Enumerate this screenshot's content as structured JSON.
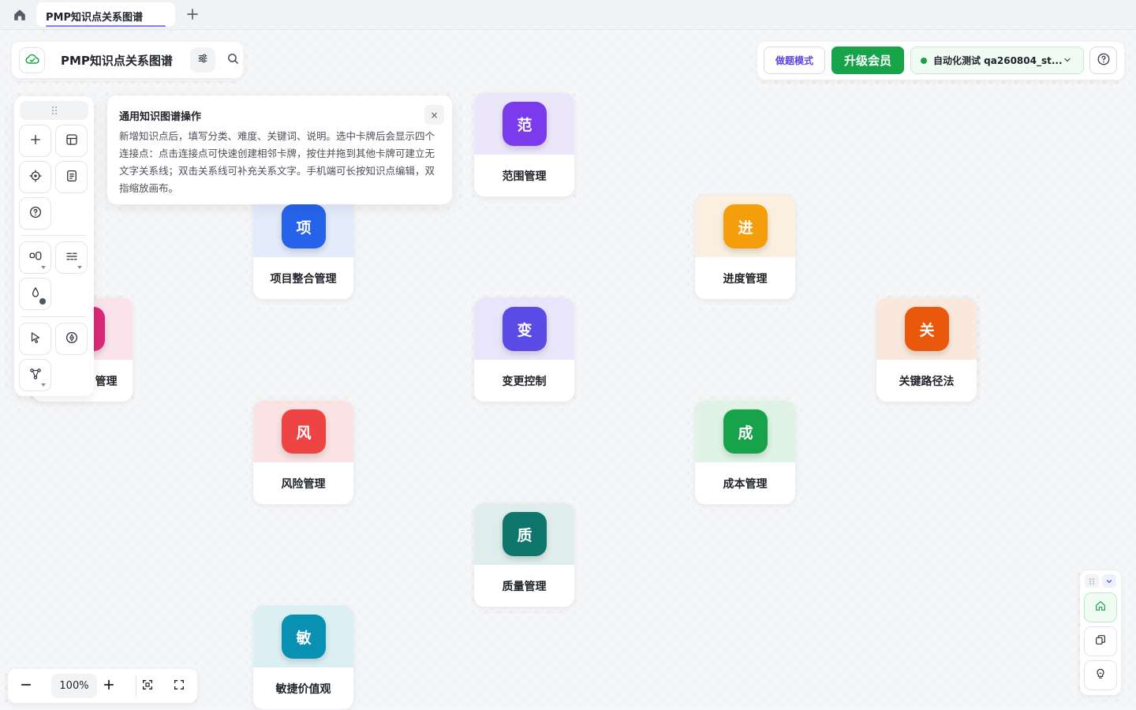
{
  "tab": {
    "title": "PMP知识点关系图谱"
  },
  "header": {
    "title": "PMP知识点关系图谱",
    "practice_label": "做题模式",
    "upgrade_label": "升级会员",
    "user_label": "自动化测试 qa260804_st..."
  },
  "tip": {
    "title": "通用知识图谱操作",
    "body": "新增知识点后，填写分类、难度、关键词、说明。选中卡牌后会显示四个连接点：点击连接点可快速创建相邻卡牌，按住并拖到其他卡牌可建立无文字关系线；双击关系线可补充关系文字。手机端可长按知识点编辑，双指缩放画布。",
    "close": "×"
  },
  "nodes": [
    {
      "badge": "范",
      "label": "范围管理",
      "color": "#7c3aed",
      "tint": "#ece6fb"
    },
    {
      "badge": "项",
      "label": "项目整合管理",
      "color": "#2563eb",
      "tint": "#e4ebfa"
    },
    {
      "badge": "进",
      "label": "进度管理",
      "color": "#f59e0b",
      "tint": "#fbf0df"
    },
    {
      "badge": "变",
      "label": "变更控制",
      "color": "#5b4be6",
      "tint": "#e9e6fb"
    },
    {
      "badge": "关",
      "label": "关键路径法",
      "color": "#ea580c",
      "tint": "#fbe8dc"
    },
    {
      "badge": "",
      "label": "管理",
      "color": "#db2777",
      "tint": "#fbe3ec"
    },
    {
      "badge": "风",
      "label": "风险管理",
      "color": "#ef4444",
      "tint": "#fbe3e3"
    },
    {
      "badge": "成",
      "label": "成本管理",
      "color": "#16a34a",
      "tint": "#e0f3e6"
    },
    {
      "badge": "质",
      "label": "质量管理",
      "color": "#0f766e",
      "tint": "#dfeeec"
    },
    {
      "badge": "敏",
      "label": "敏捷价值观",
      "color": "#0891b2",
      "tint": "#dcf0f4"
    }
  ],
  "zoom": {
    "value": "100%"
  },
  "icons": {
    "home": "home-icon",
    "add_tab": "plus-icon",
    "cloud": "cloud-check-icon",
    "filter": "sliders-icon",
    "search": "search-icon",
    "help": "question-icon",
    "chevron": "chevron-down-icon"
  },
  "colors": {
    "accent": "#16a34a",
    "brand_purple": "#5b47e0"
  }
}
